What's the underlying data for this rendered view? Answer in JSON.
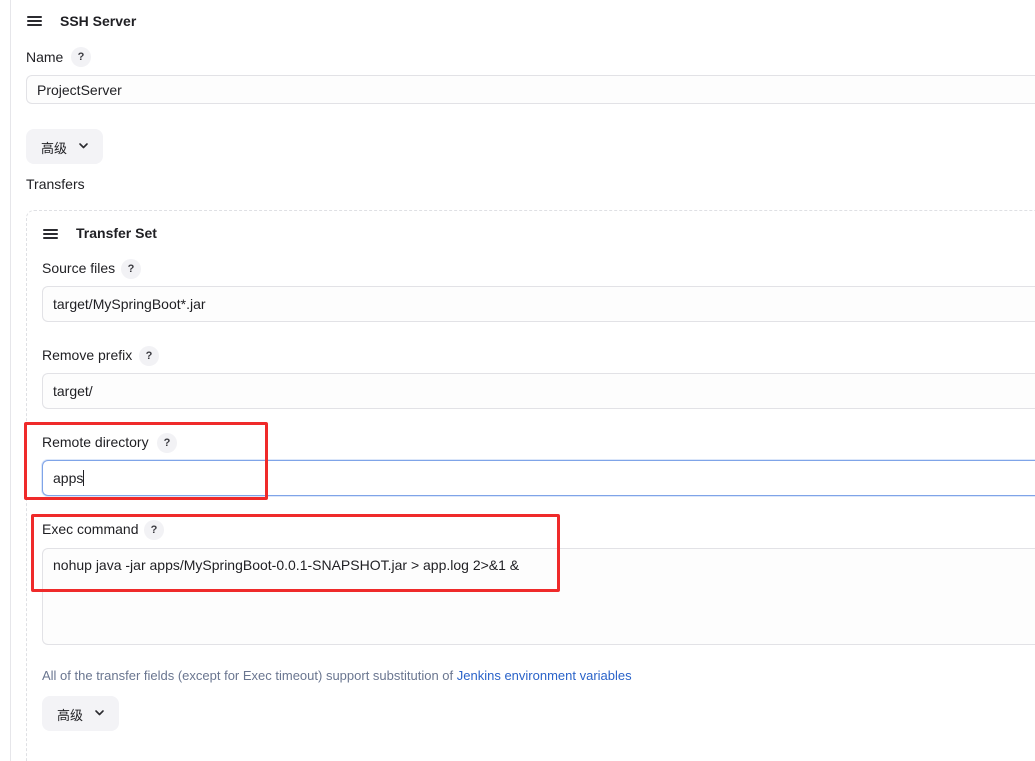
{
  "ssh_server": {
    "title": "SSH Server",
    "name_label": "Name",
    "name_value": "ProjectServer",
    "advanced_label": "高级",
    "transfers_label": "Transfers"
  },
  "transfer_set": {
    "title": "Transfer Set",
    "source_files_label": "Source files",
    "source_files_value": "target/MySpringBoot*.jar",
    "remove_prefix_label": "Remove prefix",
    "remove_prefix_value": "target/",
    "remote_directory_label": "Remote directory",
    "remote_directory_value": "apps",
    "exec_command_label": "Exec command",
    "exec_command_value": "nohup java -jar apps/MySpringBoot-0.0.1-SNAPSHOT.jar > app.log 2>&1 &",
    "hint_text": "All of the transfer fields (except for Exec timeout) support substitution of ",
    "hint_link": "Jenkins environment variables",
    "advanced_label": "高级"
  },
  "help_glyph": "?",
  "icons": {
    "drag_handle": "drag-handle-icon",
    "help": "help-icon",
    "chevron": "chevron-down-icon"
  },
  "colors": {
    "highlight": "#ef2a2a",
    "link": "#2a63c9",
    "focus": "#7fa4e8"
  }
}
